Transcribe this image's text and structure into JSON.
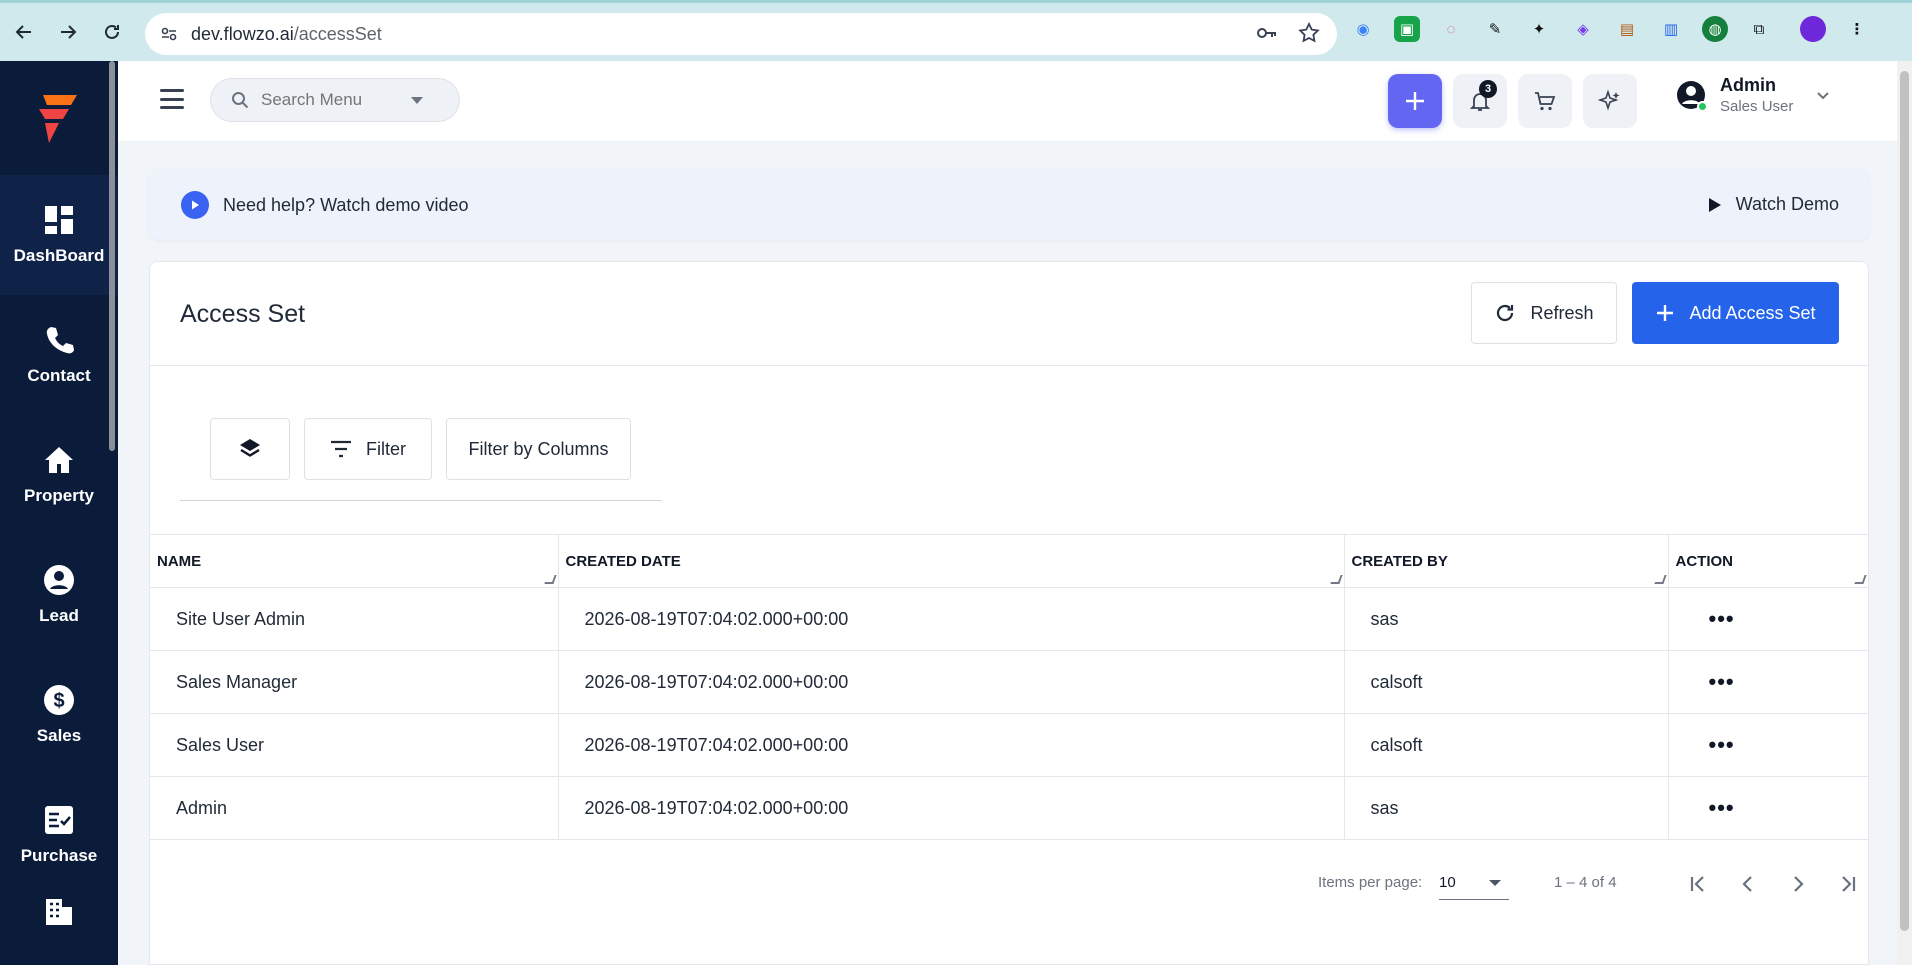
{
  "browser": {
    "url_host": "dev.flowzo.ai",
    "url_path": "/accessSet"
  },
  "sidebar": {
    "items": [
      {
        "label": "DashBoard",
        "icon": "dashboard-icon"
      },
      {
        "label": "Contact",
        "icon": "phone-icon"
      },
      {
        "label": "Property",
        "icon": "home-icon"
      },
      {
        "label": "Lead",
        "icon": "account-circle-icon"
      },
      {
        "label": "Sales",
        "icon": "dollar-icon"
      },
      {
        "label": "Purchase",
        "icon": "checklist-icon"
      }
    ]
  },
  "topbar": {
    "search_placeholder": "Search Menu",
    "notification_count": "3",
    "user_name": "Admin",
    "user_role": "Sales User"
  },
  "help": {
    "text": "Need help? Watch demo video",
    "watch_label": "Watch Demo"
  },
  "page": {
    "title": "Access Set",
    "refresh_label": "Refresh",
    "add_label": "Add Access Set",
    "filter_label": "Filter",
    "filter_columns_label": "Filter by Columns"
  },
  "table": {
    "columns": [
      "NAME",
      "CREATED DATE",
      "CREATED BY",
      "ACTION"
    ],
    "rows": [
      {
        "name": "Site User Admin",
        "created_date": "2026-08-19T07:04:02.000+00:00",
        "created_by": "sas"
      },
      {
        "name": "Sales Manager",
        "created_date": "2026-08-19T07:04:02.000+00:00",
        "created_by": "calsoft"
      },
      {
        "name": "Sales User",
        "created_date": "2026-08-19T07:04:02.000+00:00",
        "created_by": "calsoft"
      },
      {
        "name": "Admin",
        "created_date": "2026-08-19T07:04:02.000+00:00",
        "created_by": "sas"
      }
    ],
    "action_glyph": "•••"
  },
  "pagination": {
    "items_per_page_label": "Items per page:",
    "items_per_page": "10",
    "range": "1 – 4 of 4"
  },
  "colors": {
    "sidebar": "#0b1b3a",
    "primary": "#2563eb",
    "accent": "#6366f1"
  }
}
